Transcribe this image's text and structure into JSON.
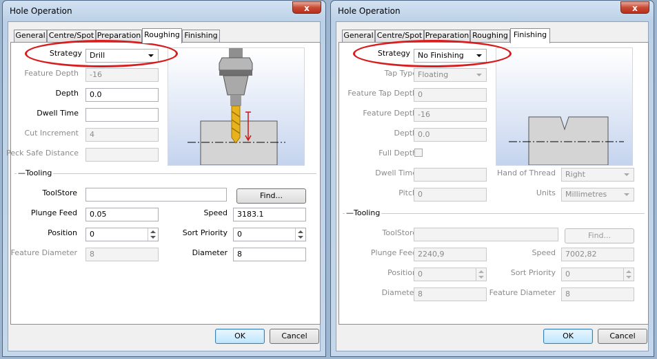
{
  "left": {
    "title": "Hole Operation",
    "close": "x",
    "tabs": [
      "General",
      "Centre/Spot",
      "Preparation",
      "Roughing",
      "Finishing"
    ],
    "strategy": {
      "label": "Strategy",
      "value": "Drill"
    },
    "feature_depth": {
      "label": "Feature Depth",
      "value": "-16"
    },
    "depth": {
      "label": "Depth",
      "value": "0.0"
    },
    "dwell_time": {
      "label": "Dwell Time",
      "value": ""
    },
    "cut_increment": {
      "label": "Cut Increment",
      "value": "4"
    },
    "peck_safe": {
      "label": "Peck Safe Distance",
      "value": ""
    },
    "tooling": "Tooling",
    "toolstore": {
      "label": "ToolStore",
      "value": "",
      "find": "Find..."
    },
    "plunge_feed": {
      "label": "Plunge Feed",
      "value": "0.05"
    },
    "speed": {
      "label": "Speed",
      "value": "3183.1"
    },
    "position": {
      "label": "Position",
      "value": "0"
    },
    "sort_priority": {
      "label": "Sort Priority",
      "value": "0"
    },
    "feature_diameter": {
      "label": "Feature Diameter",
      "value": "8"
    },
    "diameter": {
      "label": "Diameter",
      "value": "8"
    },
    "help": "?",
    "ok": "OK",
    "cancel": "Cancel"
  },
  "right": {
    "title": "Hole Operation",
    "close": "x",
    "tabs": [
      "General",
      "Centre/Spot",
      "Preparation",
      "Roughing",
      "Finishing"
    ],
    "strategy": {
      "label": "Strategy",
      "value": "No Finishing"
    },
    "tap_type": {
      "label": "Tap Type",
      "value": "Floating"
    },
    "feature_tap_depth": {
      "label": "Feature Tap Depth",
      "value": "0"
    },
    "feature_depth": {
      "label": "Feature Depth",
      "value": "-16"
    },
    "depth": {
      "label": "Depth",
      "value": "0.0"
    },
    "full_depth": {
      "label": "Full Depth"
    },
    "dwell_time": {
      "label": "Dwell Time",
      "value": ""
    },
    "hand_of_thread": {
      "label": "Hand of Thread",
      "value": "Right"
    },
    "pitch": {
      "label": "Pitch",
      "value": "0"
    },
    "units": {
      "label": "Units",
      "value": "Millimetres"
    },
    "tooling": "Tooling",
    "toolstore": {
      "label": "ToolStore",
      "value": "",
      "find": "Find..."
    },
    "plunge_feed": {
      "label": "Plunge Feed",
      "value": "2240,9"
    },
    "speed": {
      "label": "Speed",
      "value": "7002,82"
    },
    "position": {
      "label": "Position",
      "value": "0"
    },
    "sort_priority": {
      "label": "Sort Priority",
      "value": "0"
    },
    "diameter": {
      "label": "Diameter",
      "value": "8"
    },
    "feature_diameter": {
      "label": "Feature Diameter",
      "value": "8"
    },
    "help": "?",
    "ok": "OK",
    "cancel": "Cancel"
  },
  "colors": {
    "highlight_ring": "#d71d1d",
    "drill_bit": "#e8b21a",
    "stock": "#d4d4d4"
  }
}
